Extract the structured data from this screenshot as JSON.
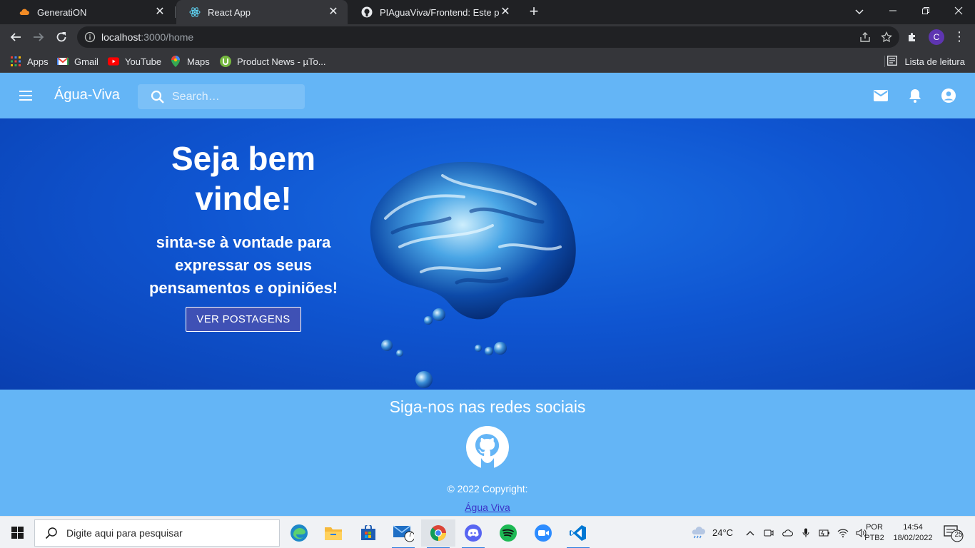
{
  "browser": {
    "tabs": [
      {
        "title": "GeneratiON",
        "active": false
      },
      {
        "title": "React App",
        "active": true
      },
      {
        "title": "PIAguaViva/Frontend: Este projeto",
        "active": false
      }
    ],
    "url_host": "localhost",
    "url_path": ":3000/home",
    "profile_initial": "C",
    "bookmarks": [
      "Apps",
      "Gmail",
      "YouTube",
      "Maps",
      "Product News - µTo..."
    ],
    "reading_list": "Lista de leitura"
  },
  "app": {
    "brand": "Água-Viva",
    "search_placeholder": "Search…",
    "hero": {
      "title": "Seja bem vinde!",
      "subtitle": "sinta-se à vontade para expressar os seus pensamentos e opiniões!",
      "button": "VER POSTAGENS"
    },
    "footer": {
      "title": "Siga-nos nas redes sociais",
      "copyright": "© 2022 Copyright:",
      "link": "Água Viva"
    }
  },
  "taskbar": {
    "search_placeholder": "Digite aqui para pesquisar",
    "mail_badge": "7",
    "weather": "24°C",
    "lang_top": "POR",
    "lang_bottom": "PTB2",
    "time": "14:54",
    "date": "18/02/2022",
    "notification_count": "25"
  },
  "colors": {
    "appbar": "#64b5f6",
    "hero_blue": "#0f55d1",
    "button": "#3f51b5"
  }
}
